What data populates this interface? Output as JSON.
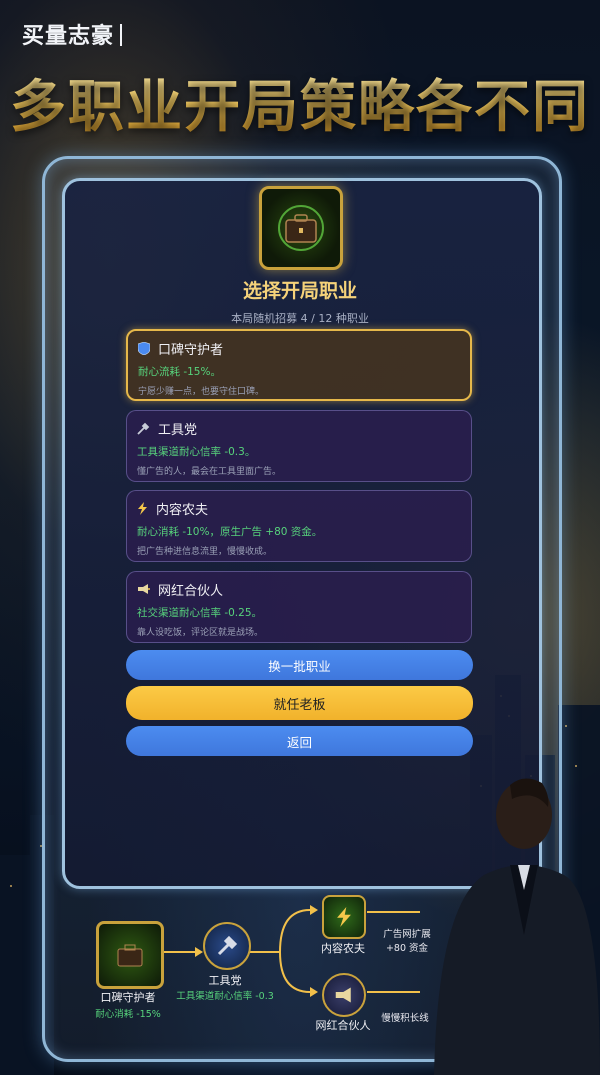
{
  "brand": {
    "name": "买量志豪"
  },
  "headline": "多职业开局策略各不同",
  "panel": {
    "title": "选择开局职业",
    "subtitle": "本局随机招募 4 / 12 种职业",
    "icon": "briefcase-icon"
  },
  "jobs": [
    {
      "name": "口碑守护者",
      "effect": "耐心流耗 -15%。",
      "desc": "宁愿少赚一点，也要守住口碑。",
      "icon": "shield-icon",
      "selected": true
    },
    {
      "name": "工具党",
      "effect": "工具渠道耐心信率 -0.3。",
      "desc": "懂广告的人，最会在工具里面广告。",
      "icon": "wrench-icon",
      "selected": false
    },
    {
      "name": "内容农夫",
      "effect": "耐心消耗 -10%，原生广告 +80 资金。",
      "desc": "把广告种进信息流里，慢慢收成。",
      "icon": "lightning-icon",
      "selected": false
    },
    {
      "name": "网红合伙人",
      "effect": "社交渠道耐心信率 -0.25。",
      "desc": "靠人设吃饭，评论区就是战场。",
      "icon": "megaphone-icon",
      "selected": false
    }
  ],
  "buttons": {
    "reroll": "换一批职业",
    "confirm": "就任老板",
    "back": "返回"
  },
  "flow": {
    "start": {
      "label": "口碑守护者",
      "effect": "耐心消耗 -15%"
    },
    "mid": {
      "label": "工具党",
      "effect": "工具渠道耐心信率 -0.3"
    },
    "top": {
      "label": "内容农夫",
      "note_line1": "广告网扩展",
      "note_line2": "+80 资金"
    },
    "bottom": {
      "label": "网红合伙人",
      "note": "慢慢积长线"
    }
  },
  "colors": {
    "accent_gold": "#f5c95a",
    "effect_green": "#57d37c",
    "button_blue": "#4c8cf0",
    "button_gold": "#fcca46"
  }
}
